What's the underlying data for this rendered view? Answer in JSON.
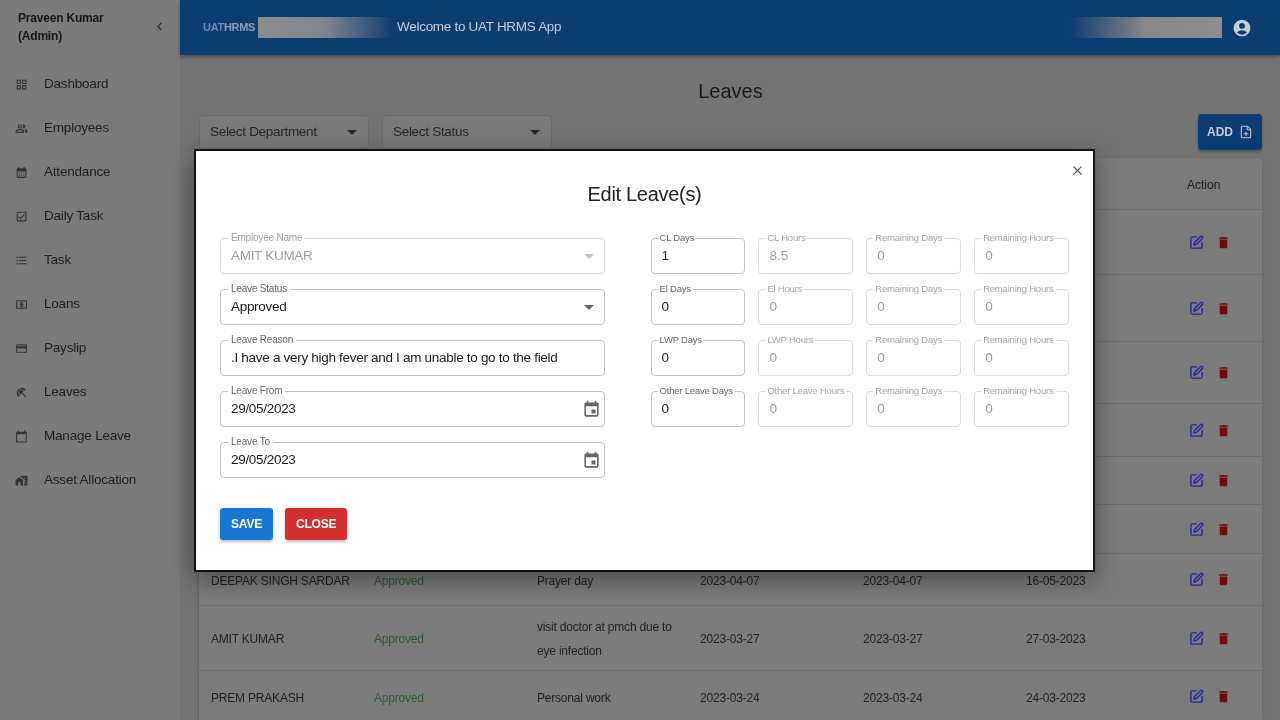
{
  "sidebar": {
    "user": "Praveen Kumar (Admin)",
    "items": [
      {
        "label": "Dashboard"
      },
      {
        "label": "Employees"
      },
      {
        "label": "Attendance"
      },
      {
        "label": "Daily Task"
      },
      {
        "label": "Task"
      },
      {
        "label": "Loans"
      },
      {
        "label": "Payslip"
      },
      {
        "label": "Leaves"
      },
      {
        "label": "Manage Leave"
      },
      {
        "label": "Asset Allocation"
      }
    ]
  },
  "header": {
    "logo": [
      "UAT",
      "HRMS"
    ],
    "welcome": "Welcome to UAT HRMS App"
  },
  "page": {
    "title": "Leaves",
    "filters": [
      {
        "placeholder": "Select Department"
      },
      {
        "placeholder": "Select Status"
      }
    ],
    "add_button": "ADD"
  },
  "table": {
    "action_header": "Action",
    "rows": [
      {},
      {},
      {},
      {},
      {},
      {},
      {
        "cells": [
          "DEEPAK SINGH SARDAR",
          "Approved",
          "Prayer day",
          "2023-04-07",
          "2023-04-07",
          "16-05-2023"
        ]
      },
      {
        "cells": [
          "AMIT KUMAR",
          "Approved",
          "visit doctor at pmch due to eye infection",
          "2023-03-27",
          "2023-03-27",
          "27-03-2023"
        ]
      },
      {
        "cells": [
          "PREM PRAKASH",
          "Approved",
          "Personal work",
          "2023-03-24",
          "2023-03-24",
          "24-03-2023"
        ]
      }
    ]
  },
  "modal": {
    "title": "Edit Leave(s)",
    "fields": [
      {
        "kind": "select",
        "label": "Employee Name",
        "value": "AMIT KUMAR",
        "disabled": true
      },
      {
        "kind": "select",
        "label": "Leave Status",
        "value": "Approved",
        "disabled": false
      },
      {
        "kind": "text",
        "label": "Leave Reason",
        "value": ".I have a very high fever and I am unable to go to the field",
        "disabled": false
      },
      {
        "kind": "date",
        "label": "Leave From",
        "value": "29/05/2023",
        "disabled": false
      },
      {
        "kind": "date",
        "label": "Leave To",
        "value": "29/05/2023",
        "disabled": false
      }
    ],
    "balances": [
      {
        "label": "CL Days",
        "value": "1",
        "disabled": false
      },
      {
        "label": "CL Hours",
        "value": "8.5",
        "disabled": true
      },
      {
        "label": "Remaining Days",
        "value": "0",
        "disabled": true
      },
      {
        "label": "Remaining Hours",
        "value": "0",
        "disabled": true
      },
      {
        "label": "El Days",
        "value": "0",
        "disabled": false
      },
      {
        "label": "El Hours",
        "value": "0",
        "disabled": true
      },
      {
        "label": "Remaining Days",
        "value": "0",
        "disabled": true
      },
      {
        "label": "Remaining Hours",
        "value": "0",
        "disabled": true
      },
      {
        "label": "LWP Days",
        "value": "0",
        "disabled": false
      },
      {
        "label": "LWP Hours",
        "value": "0",
        "disabled": true
      },
      {
        "label": "Remaining Days",
        "value": "0",
        "disabled": true
      },
      {
        "label": "Remaining Hours",
        "value": "0",
        "disabled": true
      },
      {
        "label": "Other Leave Days",
        "value": "0",
        "disabled": false
      },
      {
        "label": "Other Leave Hours",
        "value": "0",
        "disabled": true
      },
      {
        "label": "Remaining Days",
        "value": "0",
        "disabled": true
      },
      {
        "label": "Remaining Hours",
        "value": "0",
        "disabled": true
      }
    ],
    "buttons": [
      {
        "kind": "primary",
        "label": "SAVE"
      },
      {
        "kind": "danger",
        "label": "CLOSE"
      }
    ]
  }
}
